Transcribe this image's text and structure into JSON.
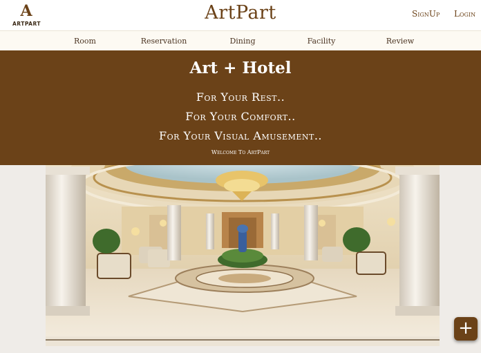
{
  "header": {
    "logo_text": "ARTPART",
    "brand": "ArtPart",
    "signup_label": "SignUp",
    "login_label": "Login"
  },
  "nav": {
    "items": [
      "Room",
      "Reservation",
      "Dining",
      "Facility",
      "Review"
    ]
  },
  "hero": {
    "title": "Art + Hotel",
    "lines": [
      "For Your Rest..",
      "For Your Comfort..",
      "For Your Visual Amusement.."
    ],
    "welcome": "Welcome To ArtPart"
  },
  "fab": {
    "icon": "plus-icon",
    "label": "+"
  },
  "colors": {
    "brand_brown": "#6b4218",
    "nav_bg": "#fdfaf3",
    "page_bg": "#efece8"
  }
}
